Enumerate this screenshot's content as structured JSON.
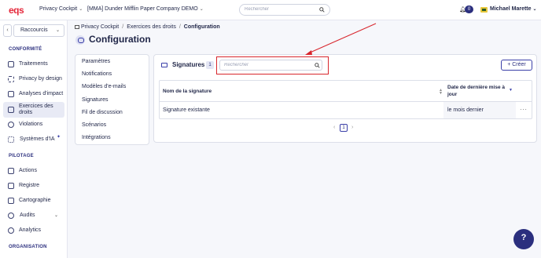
{
  "topbar": {
    "logo": "eqs",
    "product": "Privacy Cockpit",
    "company": "[MMA] Dunder Mifflin Paper Company DEMO",
    "search_placeholder": "Rechercher",
    "notification_count": "0",
    "user_name": "Michael Marette"
  },
  "sidebar": {
    "shortcut_label": "Raccourcis",
    "sections": {
      "conformite": "CONFORMITÉ",
      "pilotage": "PILOTAGE",
      "organisation": "ORGANISATION"
    },
    "items": [
      {
        "label": "Traitements",
        "icon": "list-icon"
      },
      {
        "label": "Privacy by design",
        "icon": "sparkle-icon"
      },
      {
        "label": "Analyses d'impact",
        "icon": "check-list-icon"
      },
      {
        "label": "Exercices des droits",
        "icon": "chat-icon",
        "active": true
      },
      {
        "label": "Violations",
        "icon": "alert-icon"
      },
      {
        "label": "Systèmes d'IA",
        "icon": "ai-icon"
      },
      {
        "label": "Actions",
        "icon": "tasks-icon"
      },
      {
        "label": "Registre",
        "icon": "register-icon"
      },
      {
        "label": "Cartographie",
        "icon": "map-icon"
      },
      {
        "label": "Audits",
        "icon": "audit-icon"
      },
      {
        "label": "Analytics",
        "icon": "chart-icon"
      }
    ]
  },
  "breadcrumb": {
    "home": "Privacy Cockpit",
    "parent": "Exercices des droits",
    "current": "Configuration"
  },
  "page_title": "Configuration",
  "settings_menu": [
    "Paramètres",
    "Notifications",
    "Modèles d'e-mails",
    "Signatures",
    "Fil de discussion",
    "Scénarios",
    "Intégrations"
  ],
  "signatures": {
    "title": "Signatures",
    "count": "1",
    "search_placeholder": "Rechercher",
    "create_label": "+ Créer",
    "columns": [
      "Nom de la signature",
      "Date de dernière mise à jour"
    ],
    "rows": [
      {
        "name": "Signature existante",
        "updated": "le mois dernier"
      }
    ],
    "current_page": "1"
  },
  "colors": {
    "brand_red": "#e5283b",
    "accent": "#2b2f7e",
    "highlight": "#d8262d"
  }
}
